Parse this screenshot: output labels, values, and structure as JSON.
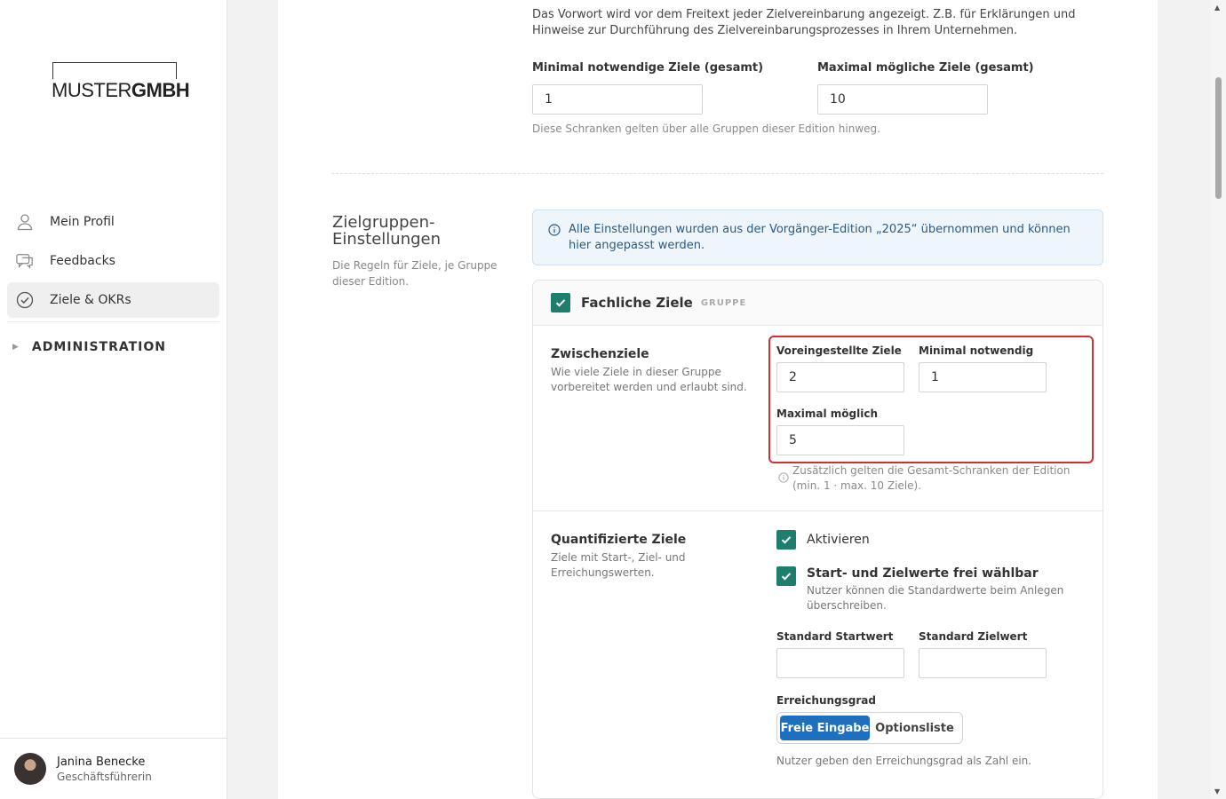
{
  "brand": {
    "logo_light": "MUSTER",
    "logo_bold": "GMBH"
  },
  "nav": {
    "items": [
      {
        "label": "Mein Profil",
        "icon": "user-icon",
        "active": false
      },
      {
        "label": "Feedbacks",
        "icon": "chat-icon",
        "active": false
      },
      {
        "label": "Ziele & OKRs",
        "icon": "check-circle-icon",
        "active": true
      }
    ],
    "section": "ADMINISTRATION"
  },
  "user": {
    "name": "Janina Benecke",
    "role": "Geschäftsführerin"
  },
  "top": {
    "description": "Das Vorwort wird vor dem Freitext jeder Zielvereinbarung angezeigt. Z.B. für Erklärungen und Hinweise zur Durchführung des Zielvereinbarungsprozesses in Ihrem Unternehmen.",
    "min_label": "Minimal notwendige Ziele (gesamt)",
    "min_value": "1",
    "max_label": "Maximal mögliche Ziele (gesamt)",
    "max_value": "10",
    "hint": "Diese Schranken gelten über alle Gruppen dieser Edition hinweg."
  },
  "section": {
    "title": "Zielgruppen-Einstellungen",
    "subtitle": "Die Regeln für Ziele, je Gruppe dieser Edition.",
    "info": "Alle Einstellungen wurden aus der Vorgänger-Edition „2025“ übernommen und können hier angepasst werden."
  },
  "group": {
    "title": "Fachliche Ziele",
    "badge": "GRUPPE",
    "zwischen": {
      "title": "Zwischenziele",
      "subtitle": "Wie viele Ziele in dieser Gruppe vorbereitet werden und erlaubt sind.",
      "preset_label": "Voreingestellte Ziele",
      "preset_value": "2",
      "min_label": "Minimal notwendig",
      "min_value": "1",
      "max_label": "Maximal möglich",
      "max_value": "5",
      "hint": "Zusätzlich gelten die Gesamt-Schranken der Edition (min. 1 · max. 10 Ziele)."
    },
    "quant": {
      "title": "Quantifizierte Ziele",
      "subtitle": "Ziele mit Start-, Ziel- und Erreichungswerten.",
      "activate_label": "Aktivieren",
      "free_label": "Start- und Zielwerte frei wählbar",
      "free_hint": "Nutzer können die Standardwerte beim Anlegen überschreiben.",
      "start_label": "Standard Startwert",
      "start_value": "",
      "target_label": "Standard Zielwert",
      "target_value": "",
      "degree_label": "Erreichungsgrad",
      "option_free": "Freie Eingabe",
      "option_list": "Optionsliste",
      "degree_hint": "Nutzer geben den Erreichungsgrad als Zahl ein."
    }
  },
  "colors": {
    "accent": "#1f6fbf",
    "check": "#1e7e6e",
    "highlight": "#d32f2f"
  }
}
